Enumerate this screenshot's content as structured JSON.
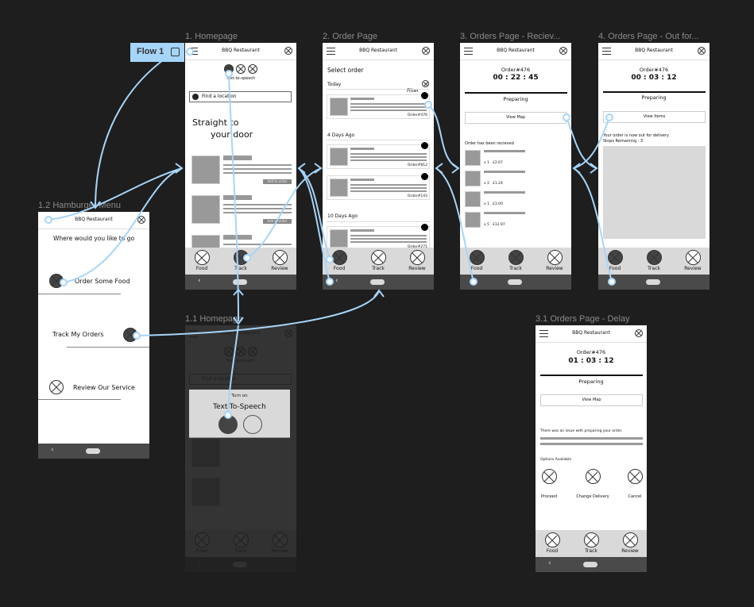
{
  "flow": {
    "label": "Flow 1",
    "icon": "play-flow-icon"
  },
  "app_title": "BBQ Restaurant",
  "nav": {
    "food": "Food",
    "track": "Track",
    "review": "Review"
  },
  "frames": {
    "menu": {
      "label": "1.2 Hamburger Menu",
      "prompt": "Where would you like to go",
      "order": "Order Some Food",
      "track": "Track My Orders",
      "review": "Review Our Service"
    },
    "home": {
      "label": "1. Homepage",
      "tts": "Text-to-speech",
      "search_placeholder": "Find a location",
      "hero1": "Straight to",
      "hero2": "your door",
      "add": "Add to order"
    },
    "home_tts": {
      "label": "1.1 Homepage",
      "turn_on": "Turn on",
      "tts_title": "Text-To-Speech"
    },
    "orders": {
      "label": "2. Order Page",
      "title": "Select order",
      "filter": "Filter",
      "groups": [
        {
          "heading": "Today",
          "orders": [
            "Order#476"
          ]
        },
        {
          "heading": "4 Days Ago",
          "orders": [
            "Order#812",
            "Order#143"
          ]
        },
        {
          "heading": "10 Days Ago",
          "orders": [
            "Order#271"
          ]
        }
      ]
    },
    "received": {
      "label": "3. Orders Page - Reciev...",
      "order": "Order#476",
      "timer": "00 : 22 : 45",
      "status": "Preparing",
      "button": "View Map",
      "note": "Order has been recieved",
      "items": [
        {
          "qty": "x 1",
          "price": "£2.67"
        },
        {
          "qty": "x 2",
          "price": "£1.24"
        },
        {
          "qty": "x 1",
          "price": "£3.00"
        },
        {
          "qty": "x 5",
          "price": "£12.97"
        }
      ]
    },
    "out": {
      "label": "4. Orders Page - Out for...",
      "order": "Order#476",
      "timer": "00 : 03 : 12",
      "status": "Preparing",
      "button": "View Items",
      "note1": "Your order is now out for delivery",
      "note2": "Stops Remaining : 3"
    },
    "delay": {
      "label": "3.1 Orders Page - Delay",
      "order": "Order#476",
      "timer": "01 : 03 : 12",
      "status": "Preparing",
      "button": "View Map",
      "issue": "There was an issue with preparing your order.",
      "options_title": "Options Available",
      "options": [
        "Proceed",
        "Change Delivery",
        "Cancel"
      ]
    }
  },
  "colors": {
    "canvas": "#1e1e1e",
    "link": "#a6d5fa",
    "frame": "#ffffff",
    "nav": "#d9d9d9",
    "system_bar": "#4a4a4a"
  }
}
